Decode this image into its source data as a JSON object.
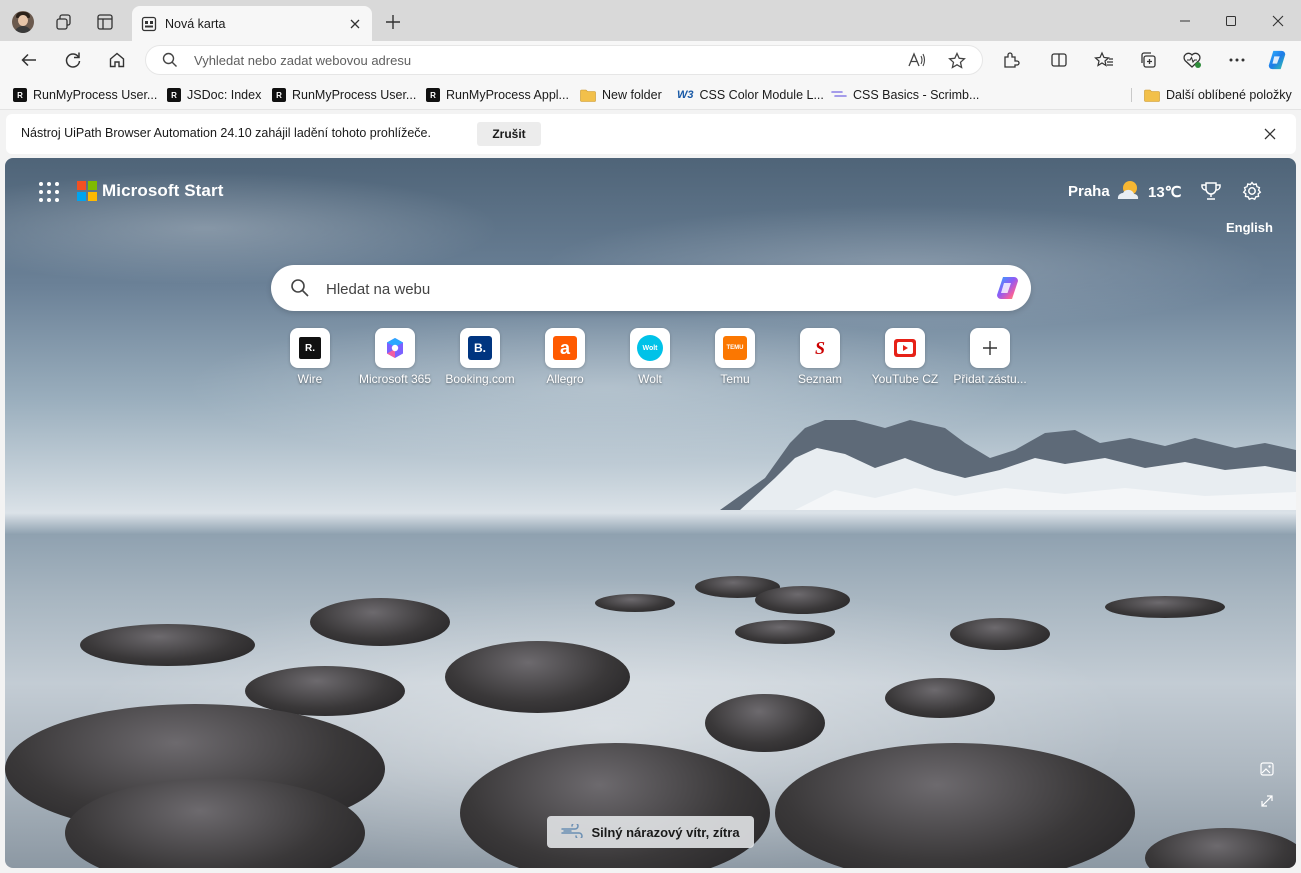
{
  "tab": {
    "title": "Nová karta"
  },
  "address": {
    "placeholder": "Vyhledat nebo zadat webovou adresu"
  },
  "bookmarks": [
    {
      "label": "RunMyProcess User...",
      "icon": "runmyprocess-icon"
    },
    {
      "label": "JSDoc: Index",
      "icon": "runmyprocess-icon"
    },
    {
      "label": "RunMyProcess User...",
      "icon": "runmyprocess-icon"
    },
    {
      "label": "RunMyProcess Appl...",
      "icon": "runmyprocess-icon"
    },
    {
      "label": "New folder",
      "icon": "folder-icon"
    },
    {
      "label": "CSS Color Module L...",
      "icon": "w3c-icon",
      "badge": "W3"
    },
    {
      "label": "CSS Basics - Scrimb...",
      "icon": "scrimba-icon"
    }
  ],
  "bookmarks_overflow": {
    "label": "Další oblíbené položky",
    "icon": "folder-icon"
  },
  "infobar": {
    "message": "Nástroj UiPath Browser Automation 24.10 zahájil ladění tohoto prohlížeče.",
    "button": "Zrušit"
  },
  "newtab": {
    "brand": "Microsoft Start",
    "weather": {
      "city": "Praha",
      "temp": "13℃",
      "icon": "partly-sunny-icon"
    },
    "language": "English",
    "search_placeholder": "Hledat na webu",
    "quick_links": [
      {
        "label": "Wire",
        "icon": "wire-icon",
        "text": "R."
      },
      {
        "label": "Microsoft 365",
        "icon": "microsoft365-icon"
      },
      {
        "label": "Booking.com",
        "icon": "booking-icon",
        "text": "B."
      },
      {
        "label": "Allegro",
        "icon": "allegro-icon",
        "text": "a"
      },
      {
        "label": "Wolt",
        "icon": "wolt-icon",
        "text": "Wolt"
      },
      {
        "label": "Temu",
        "icon": "temu-icon",
        "text": "TEMU"
      },
      {
        "label": "Seznam",
        "icon": "seznam-icon",
        "text": "S"
      },
      {
        "label": "YouTube CZ",
        "icon": "youtube-icon"
      },
      {
        "label": "Přidat zástu...",
        "icon": "plus-icon"
      }
    ],
    "news": "Silný nárazový vítr, zítra"
  },
  "colors": {
    "accent_blue": "#0078d4",
    "titlebar": "#d9d9d9",
    "toolbar": "#f7f7f7"
  }
}
